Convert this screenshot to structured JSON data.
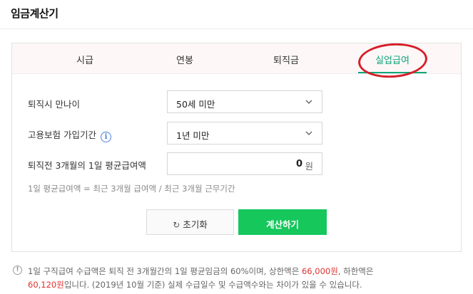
{
  "header": {
    "title": "임금계산기"
  },
  "tabs": [
    {
      "label": "시급",
      "active": false
    },
    {
      "label": "연봉",
      "active": false
    },
    {
      "label": "퇴직금",
      "active": false
    },
    {
      "label": "실업급여",
      "active": true
    }
  ],
  "form": {
    "age": {
      "label": "퇴직시 만나이",
      "value": "50세 미만"
    },
    "insurance_period": {
      "label": "고용보험 가입기간",
      "info_icon": "i",
      "value": "1년 미만"
    },
    "daily_wage": {
      "label": "퇴직전 3개월의 1일 평균급여액",
      "value": "0",
      "unit": "원"
    },
    "hint": "1일 평균급여액 = 최근 3개월 급여액 / 최근 3개월 근무기간"
  },
  "buttons": {
    "reset_icon": "↻",
    "reset_label": "초기화",
    "calculate_label": "계산하기"
  },
  "notice": {
    "icon": "!",
    "part1": "1일 구직급여 수급액은 퇴직 전 3개월간의 1일 평균임금의 60%이며, 상한액은 ",
    "max_amount": "66,000원",
    "part2": ", 하한액은",
    "min_amount": "60,120원",
    "part3": "입니다. (2019년 10월 기준) 실제 수급일수 및 수급액수와는 차이가 있을 수 있습니다."
  },
  "colors": {
    "accent_green": "#0ca678",
    "button_green": "#16c75c",
    "highlight_red": "#d6202a",
    "amount_red": "#e03131"
  }
}
